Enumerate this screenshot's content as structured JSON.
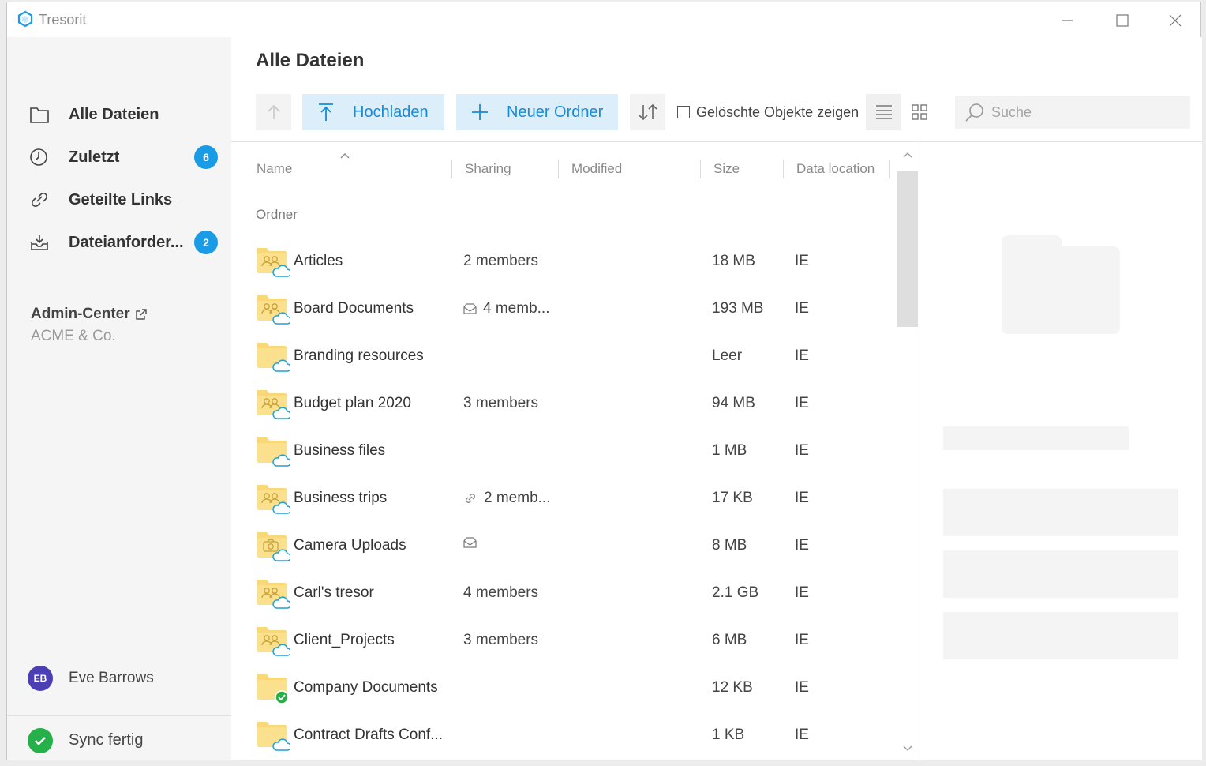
{
  "app": {
    "name": "Tresorit"
  },
  "sidebar": {
    "items": [
      {
        "label": "Alle Dateien",
        "icon": "folder-icon",
        "badge": null
      },
      {
        "label": "Zuletzt",
        "icon": "clock-icon",
        "badge": "6"
      },
      {
        "label": "Geteilte Links",
        "icon": "link-icon",
        "badge": null
      },
      {
        "label": "Dateianforder...",
        "icon": "inbox-icon",
        "badge": "2"
      }
    ],
    "admin": {
      "title": "Admin-Center",
      "org": "ACME & Co."
    },
    "user": {
      "initials": "EB",
      "name": "Eve Barrows"
    },
    "sync": {
      "label": "Sync fertig"
    }
  },
  "main": {
    "title": "Alle Dateien",
    "toolbar": {
      "upload_label": "Hochladen",
      "new_folder_label": "Neuer Ordner",
      "show_deleted_label": "Gelöschte Objekte zeigen",
      "search_placeholder": "Suche"
    },
    "columns": [
      "Name",
      "Sharing",
      "Modified",
      "Size",
      "Data location"
    ],
    "group_label": "Ordner",
    "rows": [
      {
        "name": "Articles",
        "sharing": "2 members",
        "sharing_icon": null,
        "size": "18 MB",
        "location": "IE",
        "folder_type": "shared",
        "status": "cloud"
      },
      {
        "name": "Board Documents",
        "sharing": "4 memb...",
        "sharing_icon": "mail-icon",
        "size": "193 MB",
        "location": "IE",
        "folder_type": "shared",
        "status": "cloud"
      },
      {
        "name": "Branding resources",
        "sharing": "",
        "sharing_icon": null,
        "size": "Leer",
        "location": "IE",
        "folder_type": "plain",
        "status": "cloud"
      },
      {
        "name": "Budget plan 2020",
        "sharing": "3 members",
        "sharing_icon": null,
        "size": "94 MB",
        "location": "IE",
        "folder_type": "shared",
        "status": "cloud"
      },
      {
        "name": "Business files",
        "sharing": "",
        "sharing_icon": null,
        "size": "1 MB",
        "location": "IE",
        "folder_type": "plain",
        "status": "cloud"
      },
      {
        "name": "Business trips",
        "sharing": "2 memb...",
        "sharing_icon": "link-icon",
        "size": "17 KB",
        "location": "IE",
        "folder_type": "shared",
        "status": "cloud"
      },
      {
        "name": "Camera Uploads",
        "sharing": "",
        "sharing_icon": "mail-icon",
        "size": "8 MB",
        "location": "IE",
        "folder_type": "camera",
        "status": "cloud"
      },
      {
        "name": "Carl's tresor",
        "sharing": "4 members",
        "sharing_icon": null,
        "size": "2.1 GB",
        "location": "IE",
        "folder_type": "shared",
        "status": "cloud"
      },
      {
        "name": "Client_Projects",
        "sharing": "3 members",
        "sharing_icon": null,
        "size": "6 MB",
        "location": "IE",
        "folder_type": "shared",
        "status": "cloud"
      },
      {
        "name": "Company Documents",
        "sharing": "",
        "sharing_icon": null,
        "size": "12 KB",
        "location": "IE",
        "folder_type": "plain",
        "status": "synced"
      },
      {
        "name": "Contract Drafts Conf...",
        "sharing": "",
        "sharing_icon": null,
        "size": "1 KB",
        "location": "IE",
        "folder_type": "plain",
        "status": "cloud"
      }
    ]
  },
  "colors": {
    "accent": "#1a9be6",
    "accent_bg": "#dbeef9",
    "folder": "#f9d877",
    "cloud": "#1ea0d8",
    "sync_green": "#25b04a",
    "avatar": "#4b3fb3"
  }
}
